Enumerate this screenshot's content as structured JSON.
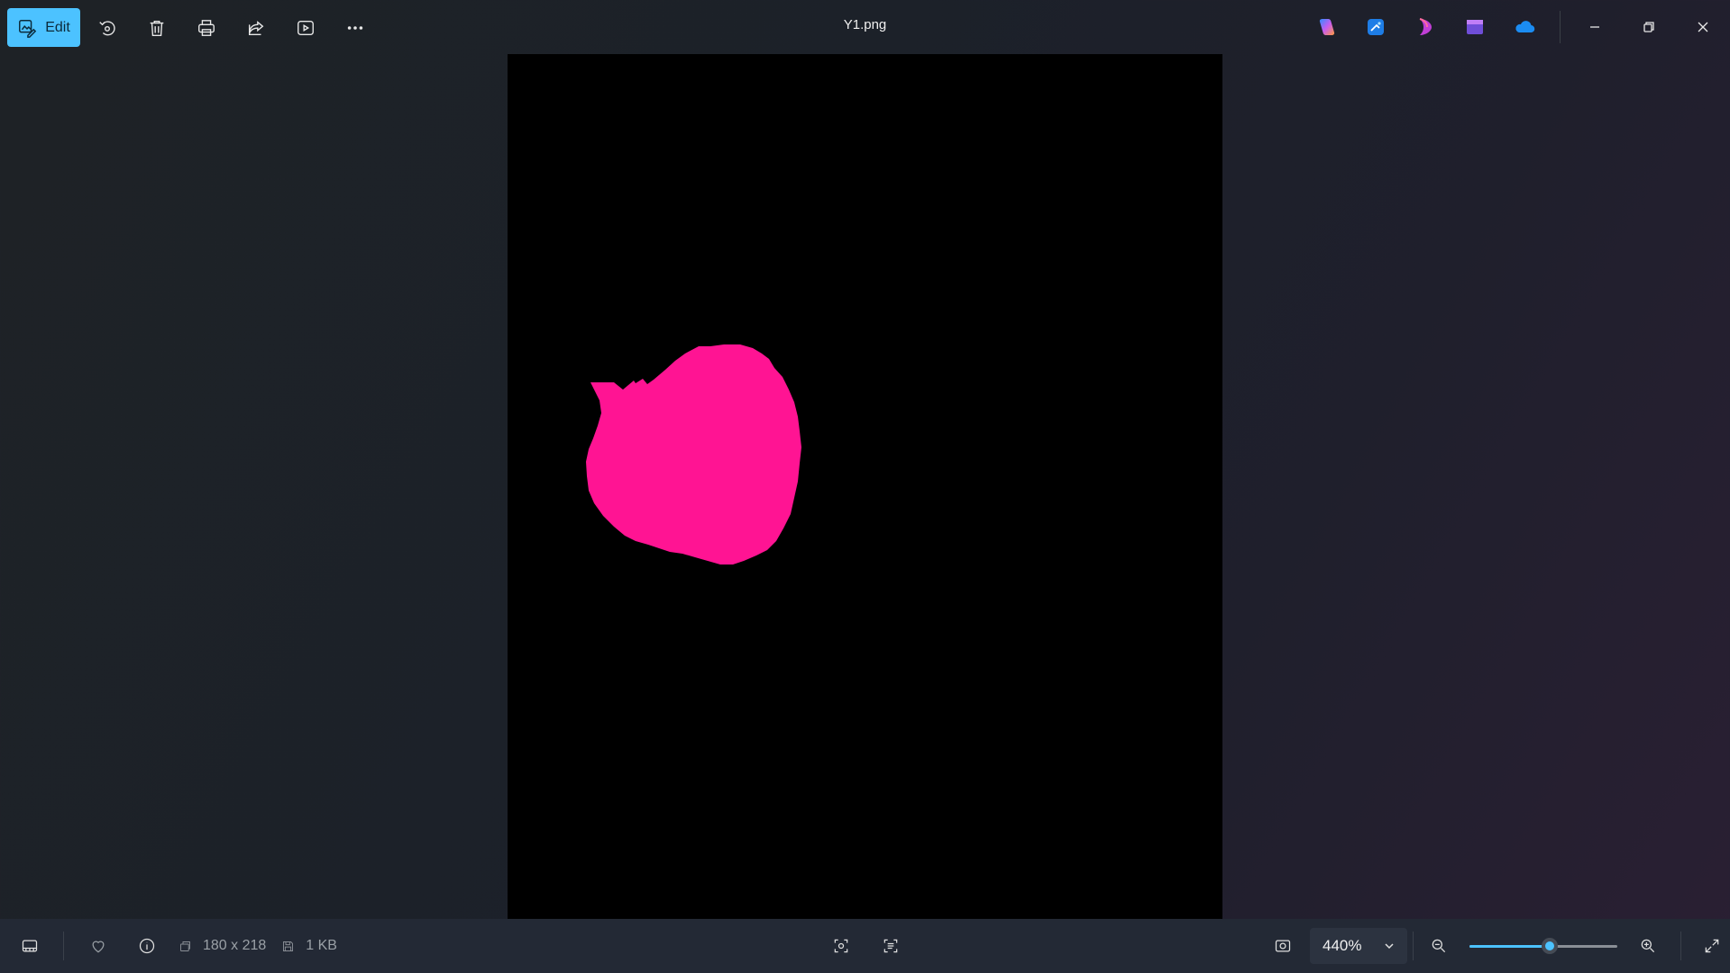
{
  "app": {
    "file_title": "Y1.png"
  },
  "toolbar": {
    "edit_label": "Edit",
    "icons": [
      "edit-icon",
      "rotate-icon",
      "delete-icon",
      "print-icon",
      "share-icon",
      "slideshow-icon",
      "more-icon"
    ]
  },
  "apps": [
    "copilot-icon",
    "designer-icon",
    "clipchamp-icon",
    "video-editor-icon",
    "onedrive-icon"
  ],
  "window": [
    "minimize-icon",
    "restore-icon",
    "close-icon"
  ],
  "image": {
    "background": "#000000",
    "shape_color": "#ff1493"
  },
  "status": {
    "dimensions": "180 x 218",
    "file_size": "1 KB",
    "zoom": "440%",
    "zoom_fraction": 0.54
  },
  "colors": {
    "accent": "#4cc2ff"
  }
}
